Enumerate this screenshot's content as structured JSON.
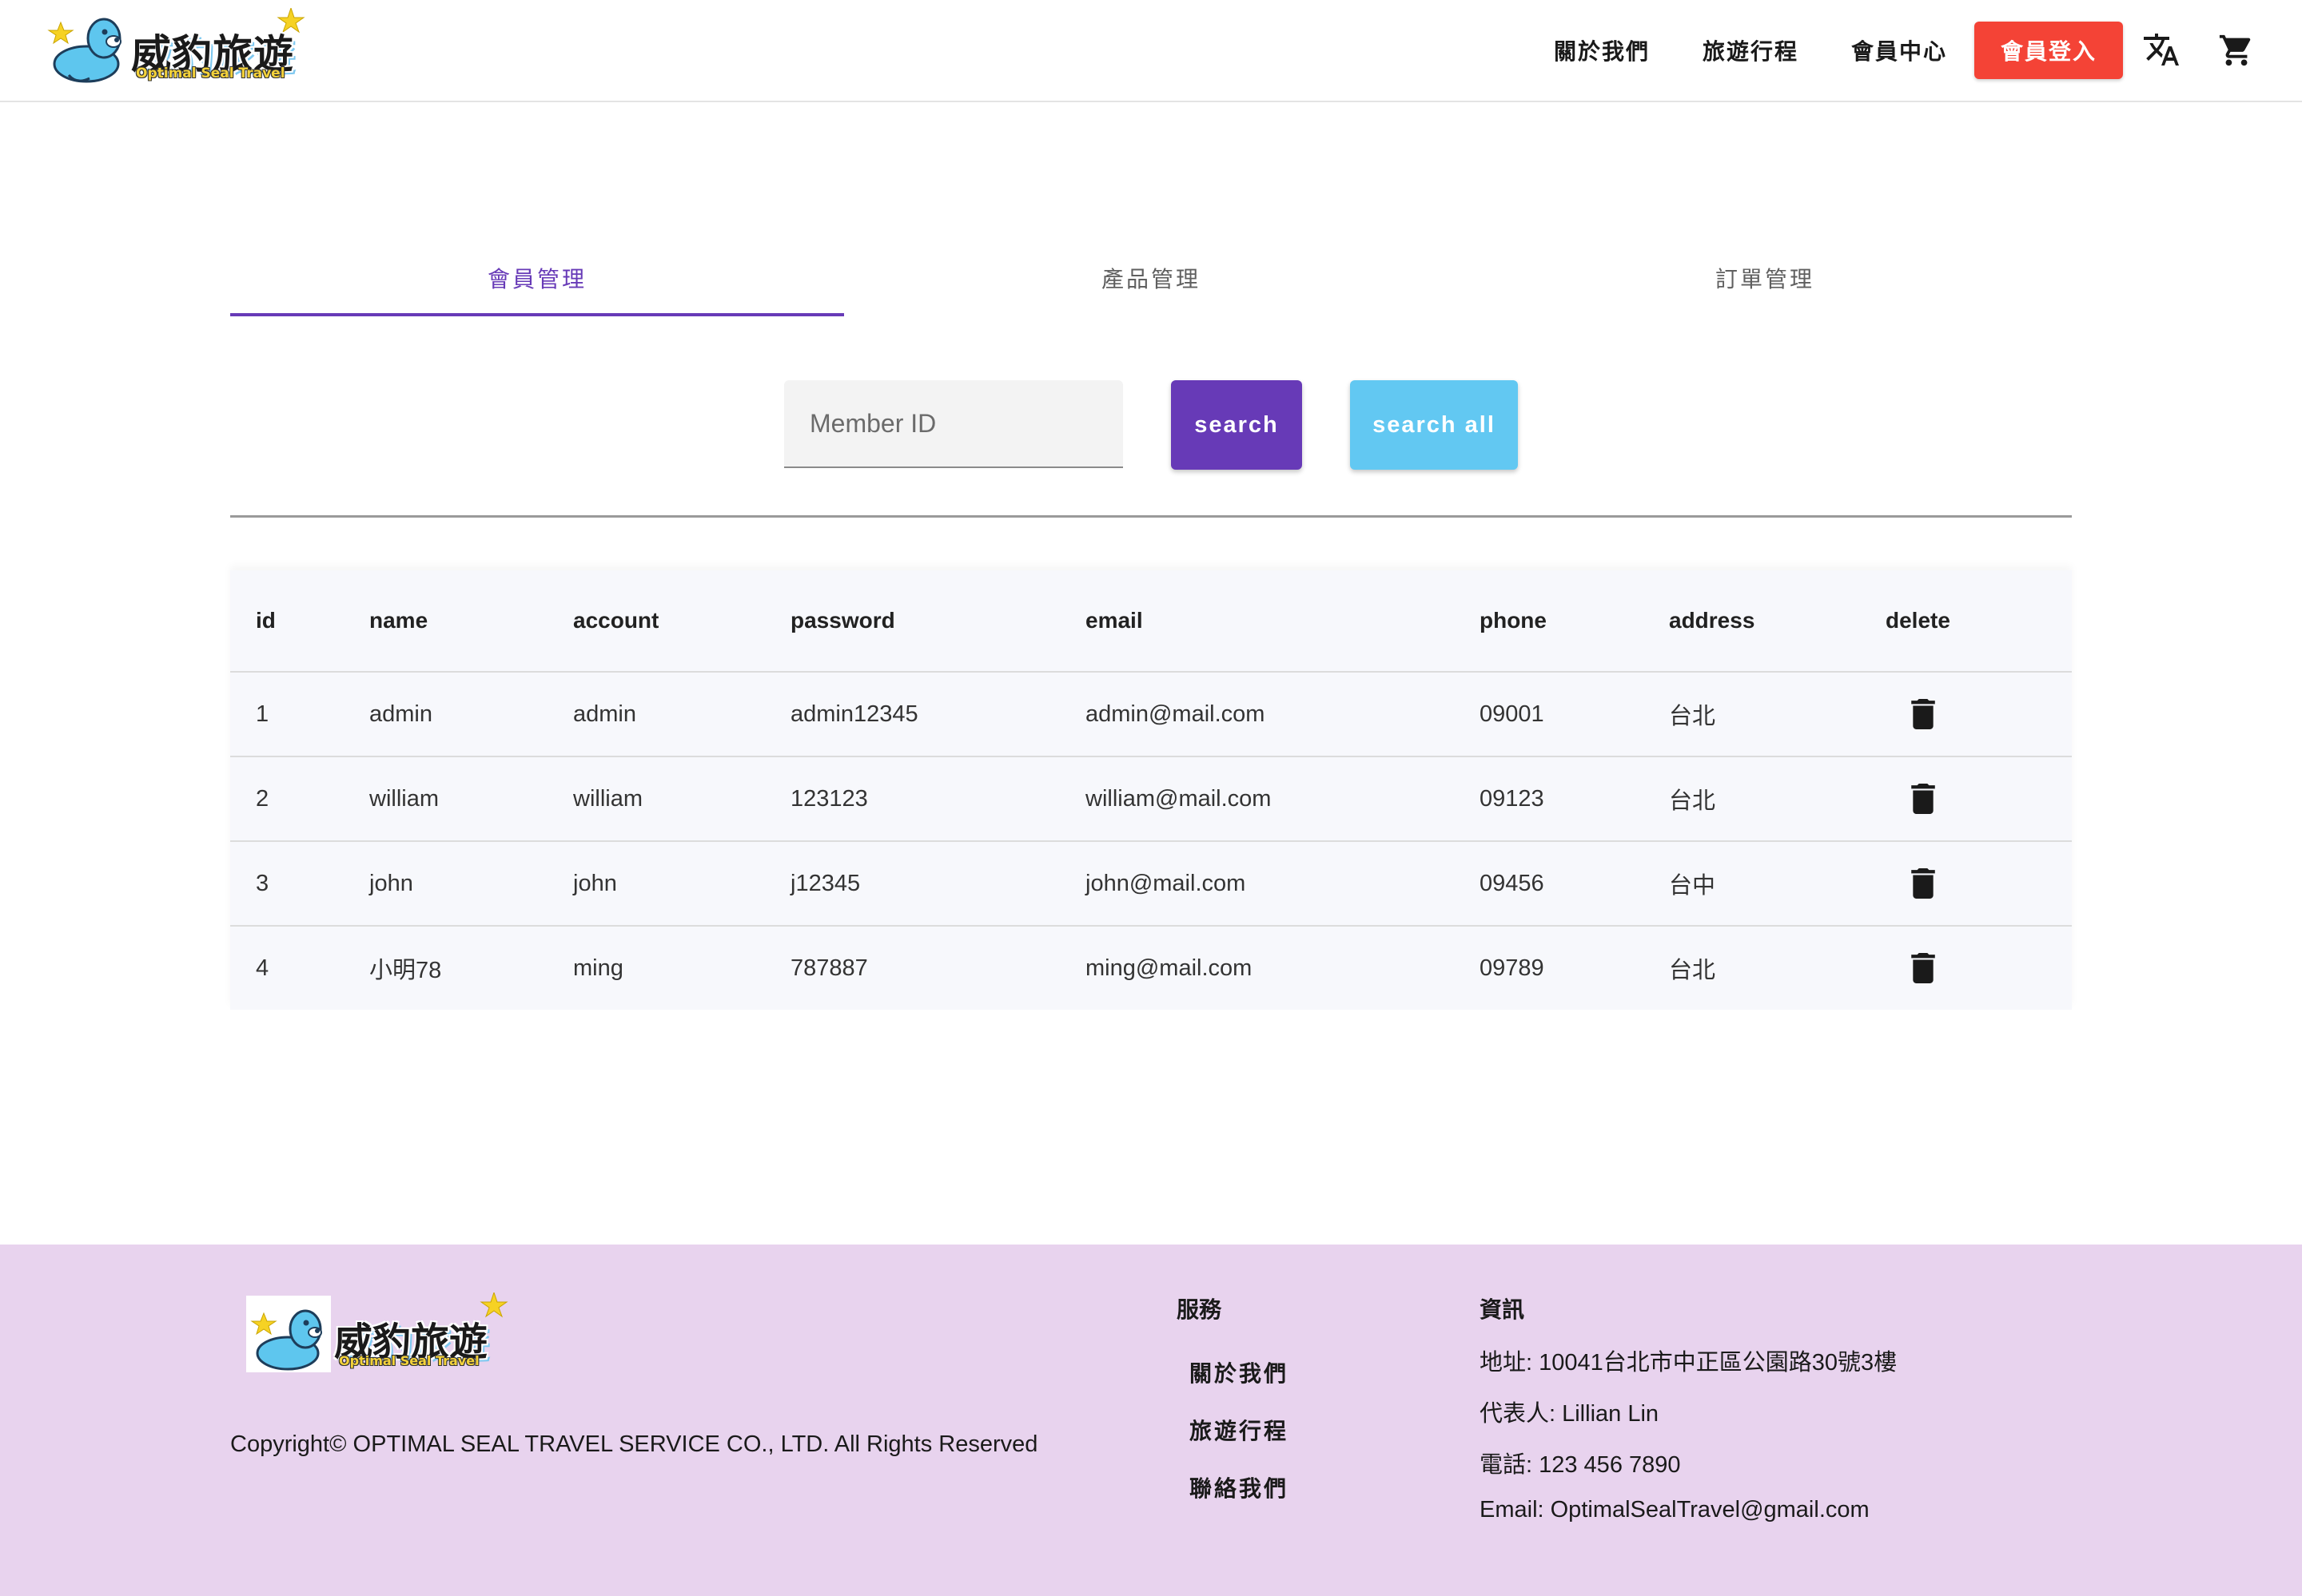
{
  "brand": {
    "name": "威豹旅遊",
    "tagline": "Optimal Seal Travel"
  },
  "nav": {
    "items": [
      "關於我們",
      "旅遊行程",
      "會員中心"
    ],
    "login_label": "會員登入"
  },
  "tabs": [
    {
      "label": "會員管理",
      "active": true
    },
    {
      "label": "產品管理",
      "active": false
    },
    {
      "label": "訂單管理",
      "active": false
    }
  ],
  "search": {
    "placeholder": "Member ID",
    "value": "",
    "search_label": "search",
    "search_all_label": "search all"
  },
  "table": {
    "columns": [
      "id",
      "name",
      "account",
      "password",
      "email",
      "phone",
      "address",
      "delete"
    ],
    "rows": [
      [
        "1",
        "admin",
        "admin",
        "admin12345",
        "admin@mail.com",
        "09001",
        "台北"
      ],
      [
        "2",
        "william",
        "william",
        "123123",
        "william@mail.com",
        "09123",
        "台北"
      ],
      [
        "3",
        "john",
        "john",
        "j12345",
        "john@mail.com",
        "09456",
        "台中"
      ],
      [
        "4",
        "小明78",
        "ming",
        "787887",
        "ming@mail.com",
        "09789",
        "台北"
      ]
    ]
  },
  "footer": {
    "copyright": "Copyright© OPTIMAL SEAL TRAVEL SERVICE CO., LTD. All Rights Reserved",
    "services_title": "服務",
    "services": [
      "關於我們",
      "旅遊行程",
      "聯絡我們"
    ],
    "info_title": "資訊",
    "info": [
      "地址: 10041台北市中正區公園路30號3樓",
      "代表人: Lillian Lin",
      "電話: 123 456 7890",
      "Email: OptimalSealTravel@gmail.com"
    ]
  },
  "icons": {
    "translate": "translate-icon",
    "cart": "shopping-cart-icon",
    "delete": "trash-icon"
  },
  "colors": {
    "primary": "#673ab7",
    "accent_light_blue": "#62c8f2",
    "login_red": "#f44336",
    "footer_bg": "#e8d3ee",
    "table_bg": "#f7f8fc"
  }
}
